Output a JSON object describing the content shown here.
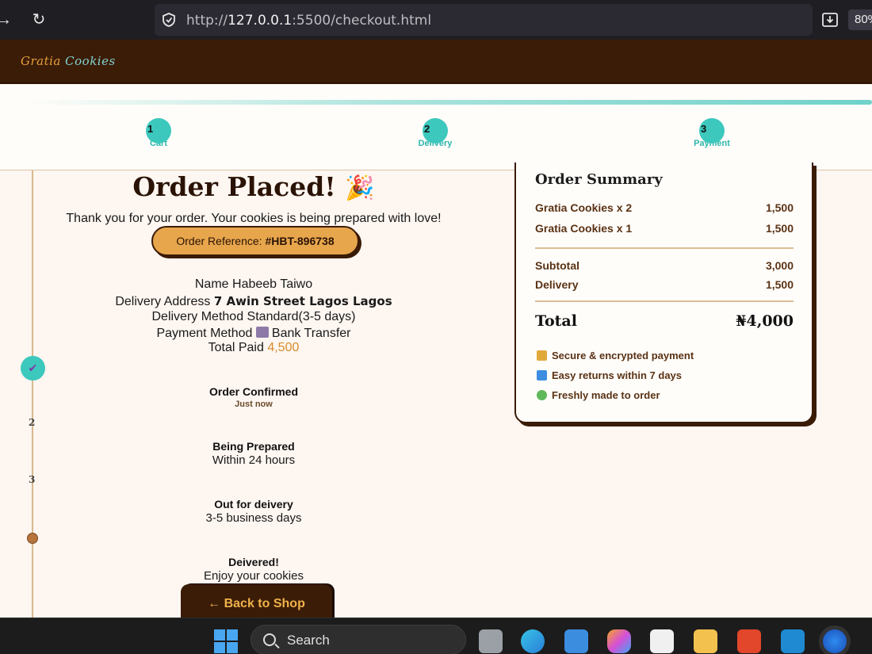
{
  "browser": {
    "url_prefix": "http://",
    "url_host": "127.0.0.1",
    "url_rest": ":5500/checkout.html",
    "zoom": "80%"
  },
  "site": {
    "logo_part1": "Gratia",
    "logo_part2": "Cookies"
  },
  "stepper": {
    "steps": [
      {
        "num": "1",
        "label": "Cart"
      },
      {
        "num": "2",
        "label": "Delivery"
      },
      {
        "num": "3",
        "label": "Payment"
      }
    ]
  },
  "confirmation": {
    "title": "Order Placed!",
    "party_icon": "🎉",
    "thanks": "Thank you for your order. Your cookies is being prepared with love!",
    "ref_label": "Order Reference: ",
    "ref_value": "#HBT-896738",
    "name_label": "Name",
    "name_value": "Habeeb Taiwo",
    "address_label": "Delivery Address",
    "address_value": "7 Awin Street Lagos Lagos",
    "method_label": "Delivery Method",
    "method_value": "Standard(3-5 days)",
    "payment_label": "Payment Method",
    "payment_value": "Bank Transfer",
    "paid_label": "Total Paid",
    "paid_value": "4,500"
  },
  "timeline": {
    "markers": [
      "2",
      "3"
    ],
    "steps": [
      {
        "title": "Order Confirmed",
        "sub": "Just now"
      },
      {
        "title": "Being Prepared",
        "sub": "Within 24 hours"
      },
      {
        "title": "Out for deivery",
        "sub": "3-5 business days"
      },
      {
        "title": "Deivered!",
        "sub": "Enjoy your cookies"
      }
    ]
  },
  "back_button": "← Back to Shop",
  "summary": {
    "title": "Order Summary",
    "items": [
      {
        "name": "Gratia Cookies x 2",
        "price": "1,500"
      },
      {
        "name": "Gratia Cookies x 1",
        "price": "1,500"
      }
    ],
    "subtotal_label": "Subtotal",
    "subtotal_value": "3,000",
    "delivery_label": "Delivery",
    "delivery_value": "1,500",
    "total_label": "Total",
    "total_value": "₦4,000",
    "features": [
      "Secure & encrypted payment",
      "Easy returns within 7 days",
      "Freshly made to order"
    ]
  },
  "taskbar": {
    "search_label": "Search"
  },
  "colors": {
    "accent_teal": "#3dc8bd",
    "brand_brown": "#3b1c07",
    "accent_orange": "#e8a64c"
  }
}
